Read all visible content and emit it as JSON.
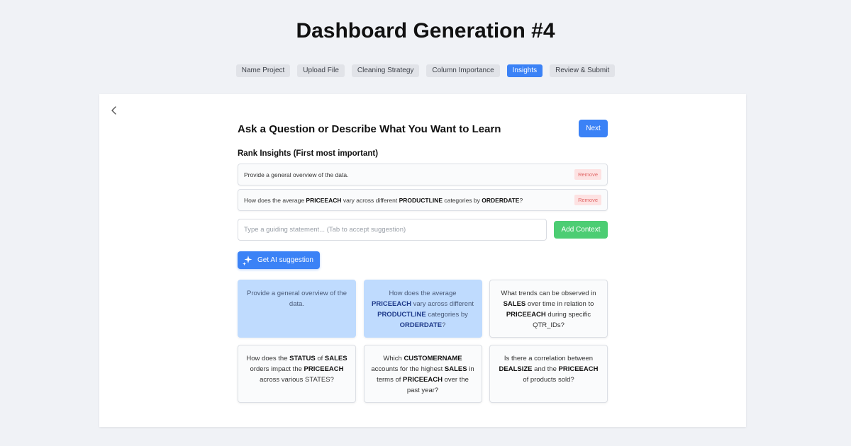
{
  "page": {
    "title": "Dashboard Generation #4"
  },
  "steps": [
    {
      "label": "Name Project",
      "active": false
    },
    {
      "label": "Upload File",
      "active": false
    },
    {
      "label": "Cleaning Strategy",
      "active": false
    },
    {
      "label": "Column Importance",
      "active": false
    },
    {
      "label": "Insights",
      "active": true
    },
    {
      "label": "Review & Submit",
      "active": false
    }
  ],
  "main": {
    "heading": "Ask a Question or Describe What You Want to Learn",
    "next_label": "Next",
    "rank_title": "Rank Insights (First most important)",
    "remove_label": "Remove",
    "ranked": [
      [
        {
          "t": "Provide a general overview of the data.",
          "b": false
        }
      ],
      [
        {
          "t": "How does the average ",
          "b": false
        },
        {
          "t": "PRICEEACH",
          "b": true
        },
        {
          "t": " vary across different ",
          "b": false
        },
        {
          "t": "PRODUCTLINE",
          "b": true
        },
        {
          "t": " categories by ",
          "b": false
        },
        {
          "t": "ORDERDATE",
          "b": true
        },
        {
          "t": "?",
          "b": false
        }
      ]
    ],
    "input_placeholder": "Type a guiding statement... (Tab to accept suggestion)",
    "add_context_label": "Add Context",
    "ai_button_label": "Get AI suggestion",
    "suggestions": [
      {
        "selected": true,
        "parts": [
          {
            "t": "Provide a general overview of the data.",
            "b": false
          }
        ]
      },
      {
        "selected": true,
        "parts": [
          {
            "t": "How does the average ",
            "b": false
          },
          {
            "t": "PRICEEACH",
            "b": true
          },
          {
            "t": " vary across different ",
            "b": false
          },
          {
            "t": "PRODUCTLINE",
            "b": true
          },
          {
            "t": " categories by ",
            "b": false
          },
          {
            "t": "ORDERDATE",
            "b": true
          },
          {
            "t": "?",
            "b": false
          }
        ]
      },
      {
        "selected": false,
        "parts": [
          {
            "t": "What trends can be observed in ",
            "b": false
          },
          {
            "t": "SALES",
            "b": true
          },
          {
            "t": " over time in relation to ",
            "b": false
          },
          {
            "t": "PRICEEACH",
            "b": true
          },
          {
            "t": " during specific QTR_IDs?",
            "b": false
          }
        ]
      },
      {
        "selected": false,
        "parts": [
          {
            "t": "How does the ",
            "b": false
          },
          {
            "t": "STATUS",
            "b": true
          },
          {
            "t": " of ",
            "b": false
          },
          {
            "t": "SALES",
            "b": true
          },
          {
            "t": " orders impact the ",
            "b": false
          },
          {
            "t": "PRICEEACH",
            "b": true
          },
          {
            "t": " across various STATES?",
            "b": false
          }
        ]
      },
      {
        "selected": false,
        "parts": [
          {
            "t": "Which ",
            "b": false
          },
          {
            "t": "CUSTOMERNAME",
            "b": true
          },
          {
            "t": " accounts for the highest ",
            "b": false
          },
          {
            "t": "SALES",
            "b": true
          },
          {
            "t": " in terms of ",
            "b": false
          },
          {
            "t": "PRICEEACH",
            "b": true
          },
          {
            "t": " over the past year?",
            "b": false
          }
        ]
      },
      {
        "selected": false,
        "parts": [
          {
            "t": "Is there a correlation between ",
            "b": false
          },
          {
            "t": "DEALSIZE",
            "b": true
          },
          {
            "t": " and the ",
            "b": false
          },
          {
            "t": "PRICEEACH",
            "b": true
          },
          {
            "t": " of products sold?",
            "b": false
          }
        ]
      }
    ]
  },
  "icons": {
    "back": "chevron-left-icon",
    "sparkle": "sparkle-icon"
  },
  "colors": {
    "primary": "#3b82f6",
    "success": "#4ccd73",
    "selected": "#bfdbfe",
    "remove": "#fde2e2"
  }
}
